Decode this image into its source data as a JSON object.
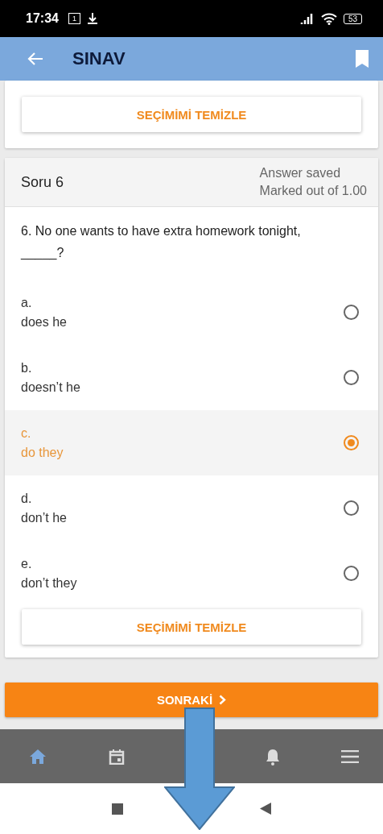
{
  "status_bar": {
    "time": "17:34",
    "calendar_day": "1",
    "battery": "53"
  },
  "app_bar": {
    "title": "SINAV"
  },
  "previous_question": {
    "clear_button": "SEÇİMİMİ TEMİZLE"
  },
  "question": {
    "title": "Soru 6",
    "status": "Answer saved",
    "mark": "Marked out of 1.00",
    "text": "6. No one wants to have extra homework tonight, _____?",
    "options": [
      {
        "letter": "a.",
        "text": "does he",
        "selected": false
      },
      {
        "letter": "b.",
        "text": "doesn’t he",
        "selected": false
      },
      {
        "letter": "c.",
        "text": "do they",
        "selected": true
      },
      {
        "letter": "d.",
        "text": "don’t he",
        "selected": false
      },
      {
        "letter": "e.",
        "text": "don’t they",
        "selected": false
      }
    ],
    "clear_button": "SEÇİMİMİ TEMİZLE"
  },
  "next_button": "SONRAKİ",
  "bottom_nav": [
    {
      "kind": "home",
      "selected": true
    },
    {
      "kind": "calendar",
      "selected": false
    },
    {
      "kind": "bell",
      "selected": false
    },
    {
      "kind": "menu",
      "selected": false
    }
  ]
}
